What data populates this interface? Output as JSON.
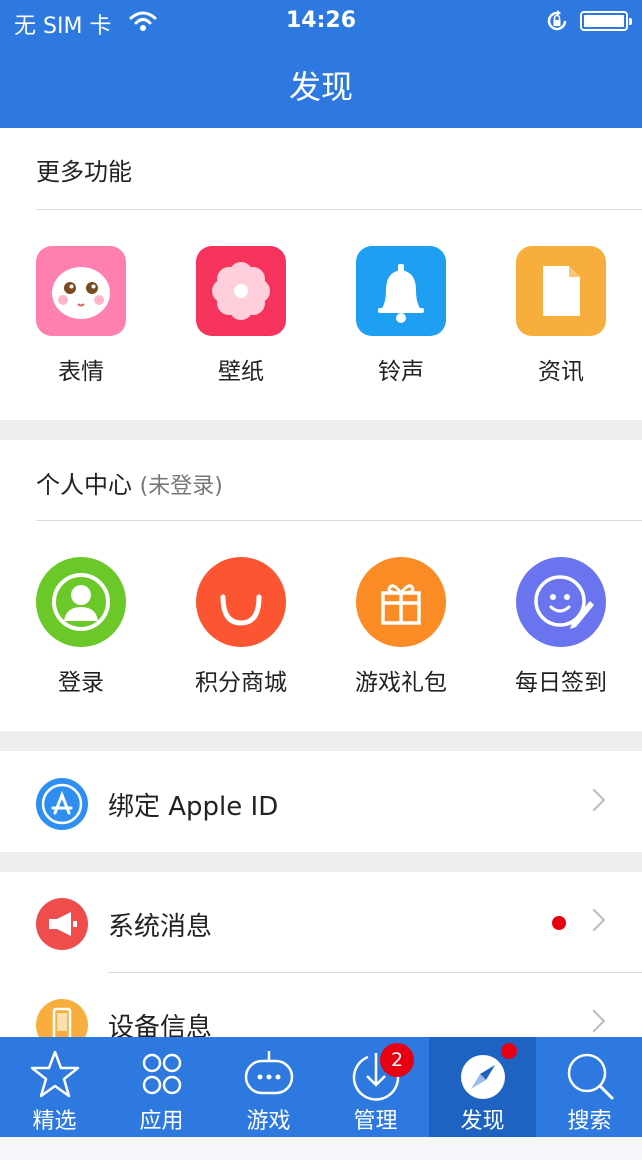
{
  "status_bar": {
    "carrier": "无 SIM 卡",
    "time": "14:26"
  },
  "header": {
    "title": "发现"
  },
  "more_features": {
    "title": "更多功能",
    "items": [
      {
        "label": "表情",
        "icon": "emoji-face-icon",
        "color": "#ff7fb0"
      },
      {
        "label": "壁纸",
        "icon": "flower-icon",
        "color": "#f5335d"
      },
      {
        "label": "铃声",
        "icon": "bell-icon",
        "color": "#1e9ff2"
      },
      {
        "label": "资讯",
        "icon": "document-icon",
        "color": "#f8ae3c"
      }
    ]
  },
  "personal_center": {
    "title": "个人中心",
    "subtitle": "(未登录)",
    "items": [
      {
        "label": "登录",
        "icon": "user-avatar-icon",
        "color": "#6ac828"
      },
      {
        "label": "积分商城",
        "icon": "smile-arc-icon",
        "color": "#fb5631"
      },
      {
        "label": "游戏礼包",
        "icon": "gift-icon",
        "color": "#fb8b24"
      },
      {
        "label": "每日签到",
        "icon": "smiley-pen-icon",
        "color": "#6a74ee"
      }
    ]
  },
  "rows": [
    {
      "label": "绑定 Apple ID",
      "icon": "app-store-icon",
      "color": "#2f8ff0"
    },
    {
      "label": "系统消息",
      "icon": "megaphone-icon",
      "color": "#ef4c4c",
      "has_dot": true
    },
    {
      "label": "设备信息",
      "icon": "phone-icon",
      "color": "#f8ae3c"
    }
  ],
  "tabbar": {
    "tabs": [
      {
        "label": "精选",
        "icon": "star-icon"
      },
      {
        "label": "应用",
        "icon": "grid-circles-icon"
      },
      {
        "label": "游戏",
        "icon": "gamepad-icon"
      },
      {
        "label": "管理",
        "icon": "download-icon",
        "badge": "2"
      },
      {
        "label": "发现",
        "icon": "compass-icon",
        "active": true
      },
      {
        "label": "搜索",
        "icon": "search-icon"
      }
    ]
  },
  "colors": {
    "brand_blue": "#2d79e0",
    "active_tab": "#1f63c2",
    "badge_red": "#e60012",
    "section_gap": "#ededed"
  }
}
